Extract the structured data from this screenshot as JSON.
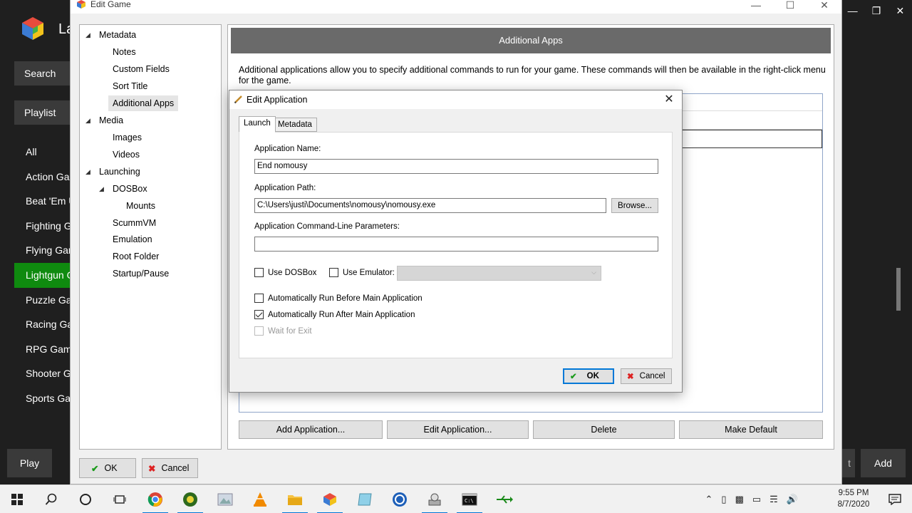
{
  "launchbox": {
    "title": "La",
    "search_label": "Search",
    "playlist_label": "Playlist",
    "playlists": [
      "All",
      "Action Ga",
      "Beat 'Em U",
      "Fighting G",
      "Flying Gar",
      "Lightgun G",
      "Puzzle Gar",
      "Racing Ga",
      "RPG Game",
      "Shooter G",
      "Sports Ga"
    ],
    "selected_playlist_index": 5,
    "play_label": "Play",
    "edit_label": "t",
    "add_label": "Add",
    "accent_color": "#0f8a0f"
  },
  "edit_game": {
    "title": "Edit Game",
    "tree": {
      "metadata": "Metadata",
      "notes": "Notes",
      "custom_fields": "Custom Fields",
      "sort_title": "Sort Title",
      "additional_apps": "Additional Apps",
      "media": "Media",
      "images": "Images",
      "videos": "Videos",
      "launching": "Launching",
      "dosbox": "DOSBox",
      "mounts": "Mounts",
      "scummvm": "ScummVM",
      "emulation": "Emulation",
      "root_folder": "Root Folder",
      "startup_pause": "Startup/Pause"
    },
    "panel_title": "Additional Apps",
    "panel_description": "Additional applications allow you to specify additional commands to run for your game.  These commands will then be available in the right-click menu for the game.",
    "buttons": {
      "add": "Add Application...",
      "edit": "Edit Application...",
      "delete": "Delete",
      "make_default": "Make Default"
    },
    "ok_label": "OK",
    "cancel_label": "Cancel"
  },
  "dialog": {
    "title": "Edit Application",
    "tabs": [
      "Launch",
      "Metadata"
    ],
    "active_tab": "Launch",
    "app_name_label": "Application Name:",
    "app_name_value": "End nomousy",
    "app_path_label": "Application Path:",
    "app_path_value": "C:\\Users\\justi\\Documents\\nomousy\\nomousy.exe",
    "browse_label": "Browse...",
    "params_label": "Application Command-Line Parameters:",
    "params_value": "",
    "use_dosbox_label": "Use DOSBox",
    "use_dosbox_checked": false,
    "use_emulator_label": "Use Emulator:",
    "use_emulator_checked": false,
    "emulator_value": "",
    "run_before_label": "Automatically Run Before Main Application",
    "run_before_checked": false,
    "run_after_label": "Automatically Run After Main Application",
    "run_after_checked": true,
    "wait_exit_label": "Wait for Exit",
    "wait_exit_checked": false,
    "wait_exit_enabled": false,
    "ok_label": "OK",
    "cancel_label": "Cancel"
  },
  "taskbar": {
    "apps": [
      "file-explorer-like-search",
      "cortana",
      "task-view",
      "chrome",
      "app-green",
      "photo-app",
      "vlc",
      "file-explorer",
      "launchbox",
      "notepad-app",
      "app-blue-circle",
      "app-tools",
      "terminal",
      "usb-app"
    ],
    "time": "9:55 PM",
    "date": "8/7/2020"
  }
}
